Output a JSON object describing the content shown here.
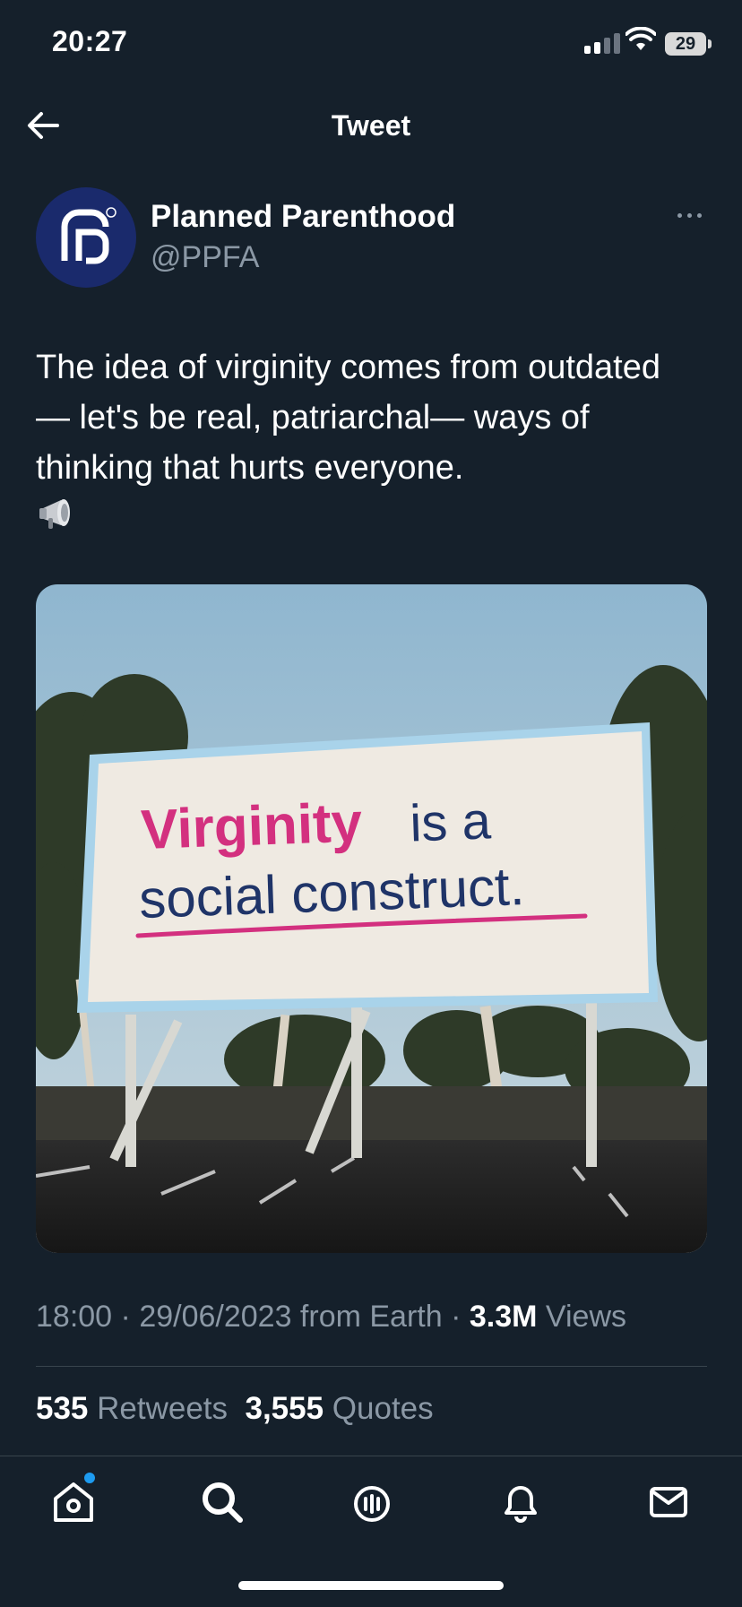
{
  "status_bar": {
    "time": "20:27",
    "battery": "29"
  },
  "header": {
    "title": "Tweet"
  },
  "author": {
    "name": "Planned Parenthood",
    "handle": "@PPFA"
  },
  "tweet": {
    "text": "The idea of virginity comes from outdated — let's be real, patriarchal— ways of thinking that hurts everyone.",
    "emoji": "megaphone-icon"
  },
  "media": {
    "billboard_word_pink": "Virginity",
    "billboard_rest_line1": " is a",
    "billboard_line2": "social construct."
  },
  "meta": {
    "time": "18:00",
    "sep1": " · ",
    "date": "29/06/2023",
    "source": " from Earth",
    "sep2": " · ",
    "views_count": "3.3M",
    "views_label": " Views"
  },
  "stats": {
    "retweets_count": "535",
    "retweets_label": " Retweets",
    "quotes_count": "3,555",
    "quotes_label": " Quotes"
  },
  "nav": [
    "home-icon",
    "search-icon",
    "spaces-icon",
    "notifications-icon",
    "messages-icon"
  ],
  "colors": {
    "background": "#15202b",
    "accent": "#1d9bf0",
    "secondary_text": "#8b98a5",
    "pink": "#d3307f",
    "navy": "#1f3468"
  }
}
